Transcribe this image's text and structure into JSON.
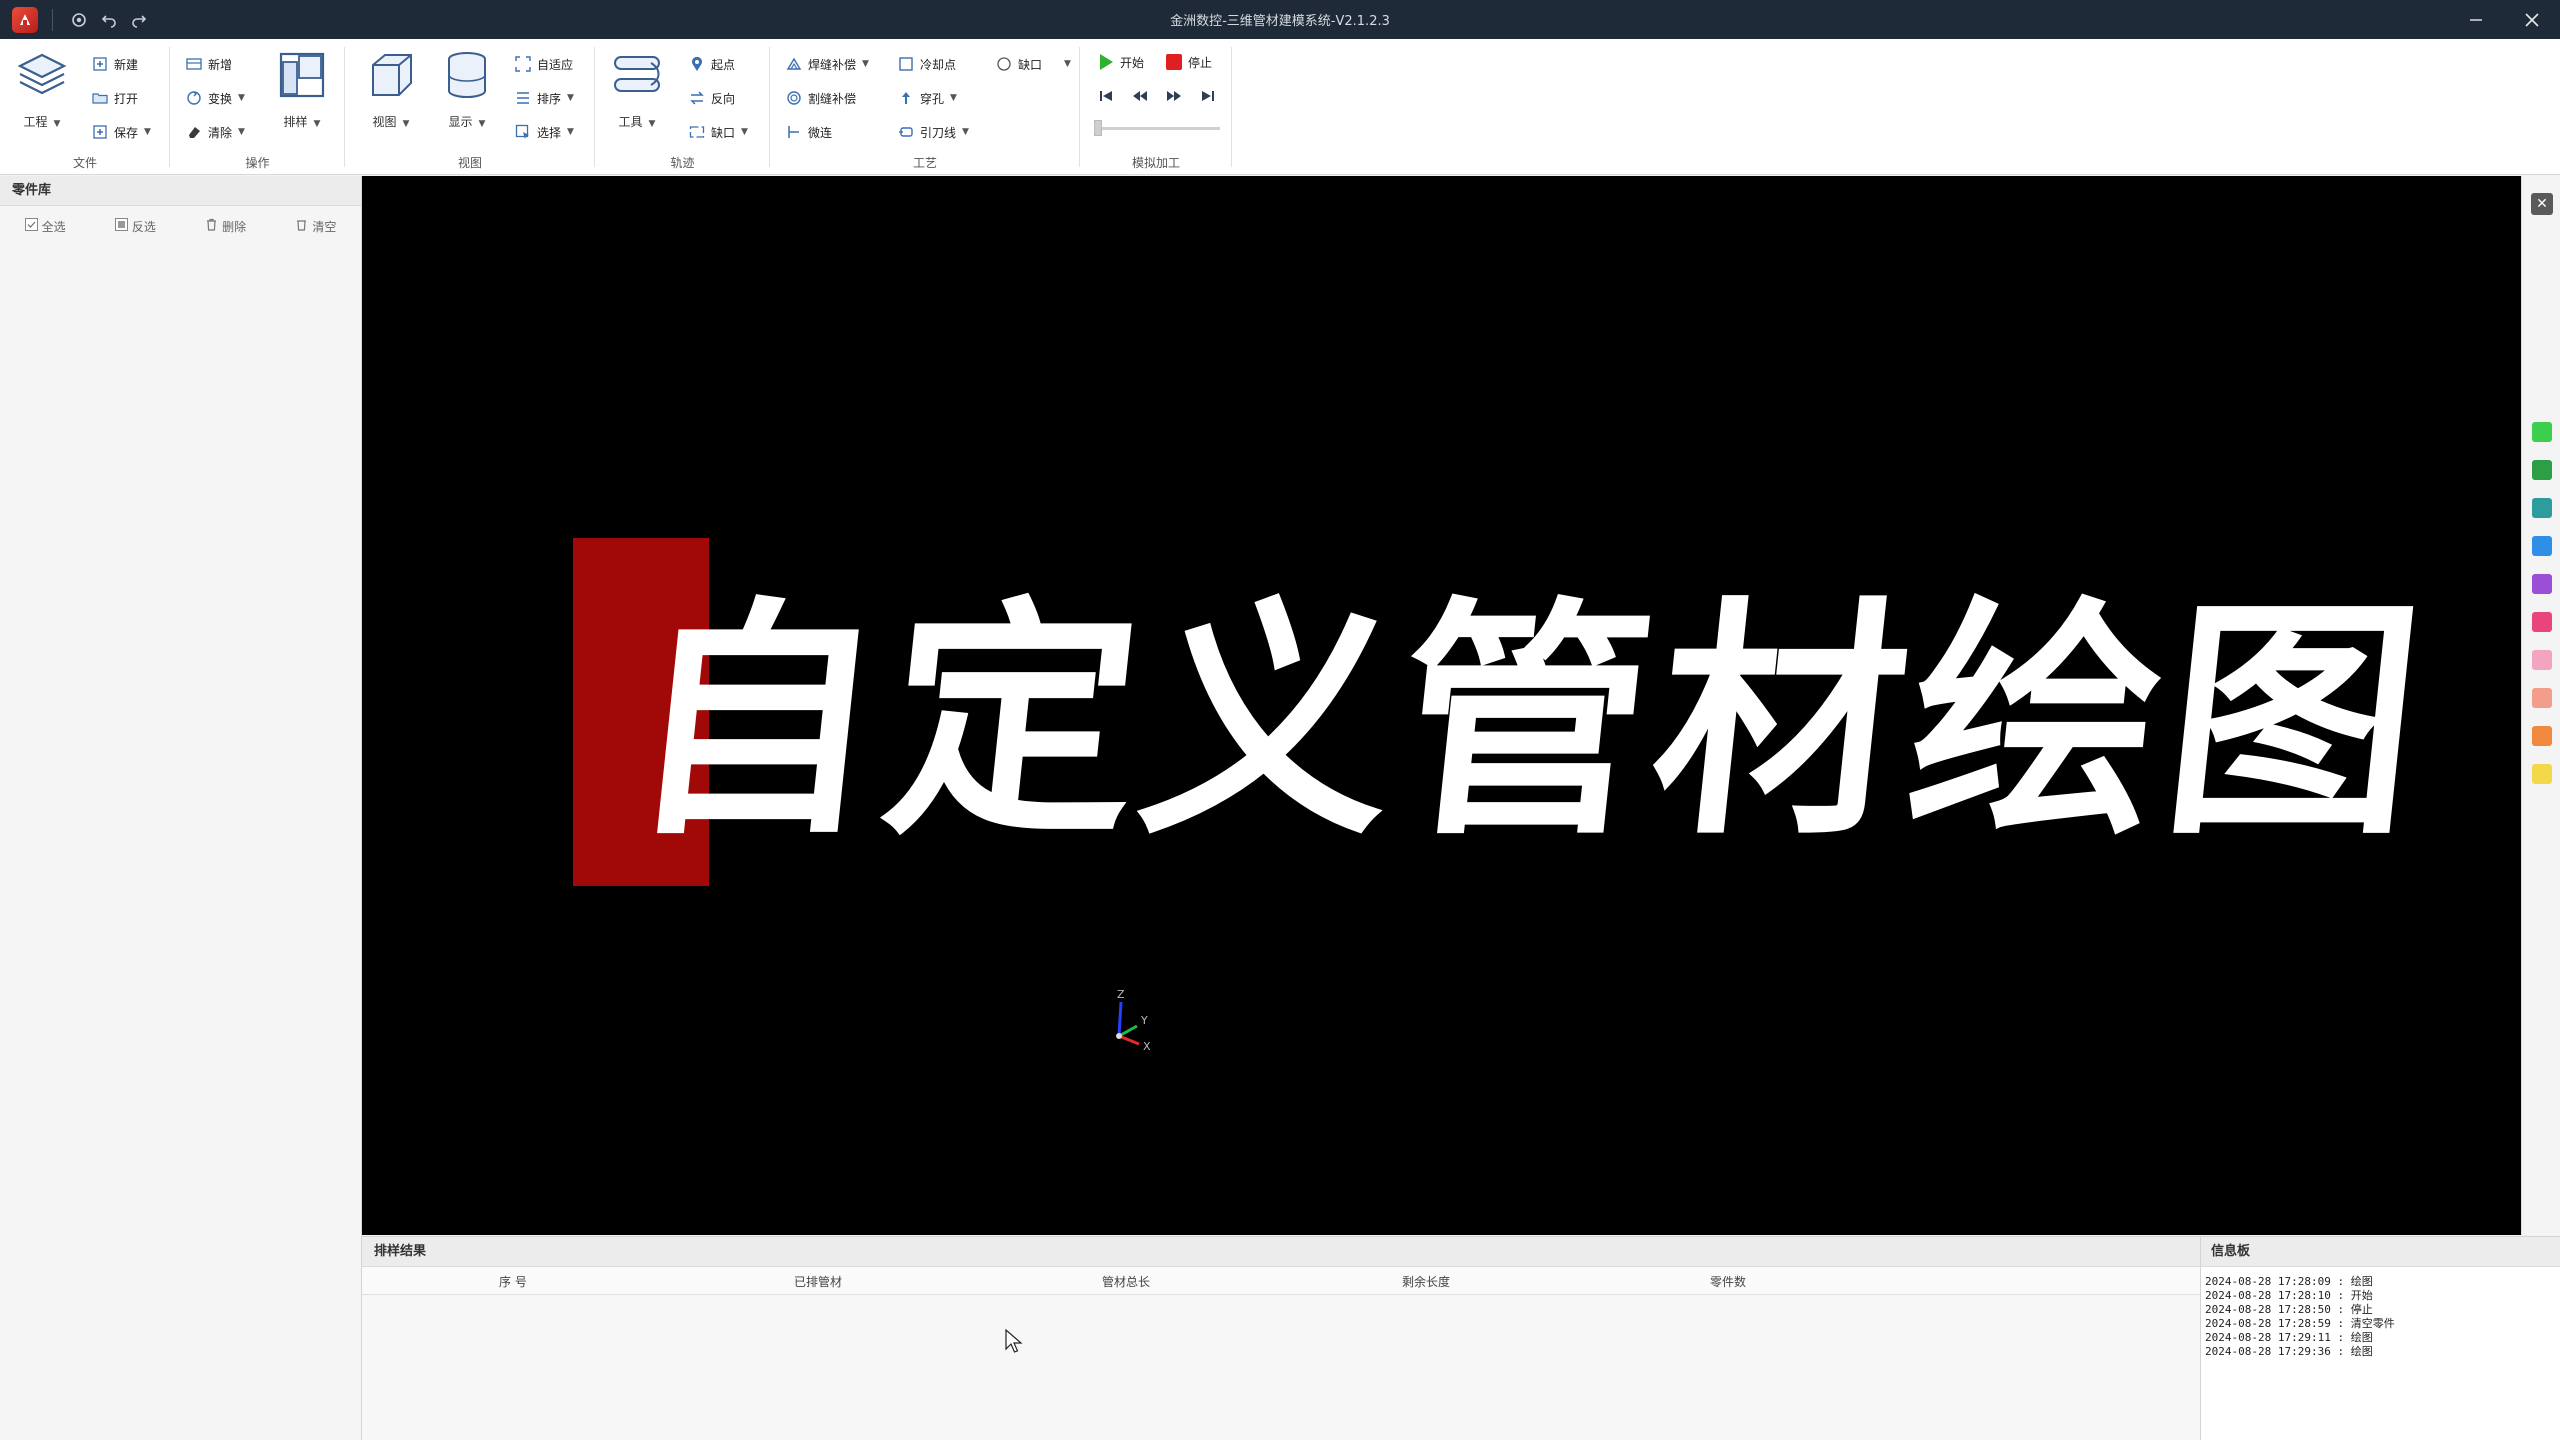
{
  "window": {
    "title": "金洲数控-三维管材建模系统-V2.1.2.3"
  },
  "ribbon": {
    "groups": {
      "file": "文件",
      "operation": "操作",
      "view": "视图",
      "track": "轨迹",
      "process": "工艺",
      "simulation": "模拟加工"
    },
    "file": {
      "project": "工程",
      "new": "新建",
      "open": "打开",
      "save": "保存"
    },
    "operation": {
      "add": "新增",
      "replace": "变换",
      "clear": "清除",
      "nest": "排样"
    },
    "view": {
      "view": "视图",
      "display": "显示",
      "auto_align": "自适应",
      "sort": "排序",
      "select": "选择"
    },
    "track": {
      "tools": "工具",
      "start_point": "起点",
      "reverse": "反向",
      "gap": "缺口"
    },
    "process": {
      "kerf_comp": "焊缝补偿",
      "cut_comp": "割缝补偿",
      "micro_joint": "微连",
      "cool_point": "冷却点",
      "pierce": "穿孔",
      "lead_line": "引刀线",
      "notch": "缺口"
    },
    "simulation": {
      "start": "开始",
      "stop": "停止",
      "progress": 0
    }
  },
  "left_panel": {
    "title": "零件库",
    "tools": {
      "select_all": "全选",
      "invert": "反选",
      "delete": "删除",
      "clear": "清空"
    }
  },
  "viewport": {
    "text": "自定义管材绘图",
    "axes": {
      "z": "Z",
      "y": "Y",
      "x": "X"
    }
  },
  "right_bar": {
    "swatches": [
      "#3ccf4e",
      "#2e9e46",
      "#2c9c9c",
      "#2f8fe6",
      "#9a4fd6",
      "#e8457b",
      "#f3a4c0",
      "#f29e8a",
      "#f0883e",
      "#f5d84a"
    ]
  },
  "result_panel": {
    "title": "排样结果",
    "columns": [
      "序 号",
      "已排管材",
      "管材总长",
      "剩余长度",
      "零件数"
    ]
  },
  "info_panel": {
    "title": "信息板",
    "logs": [
      "2024-08-28 17:28:09 : 绘图",
      "2024-08-28 17:28:10 : 开始",
      "2024-08-28 17:28:50 : 停止",
      "2024-08-28 17:28:59 : 清空零件",
      "2024-08-28 17:29:11 : 绘图",
      "2024-08-28 17:29:36 : 绘图"
    ]
  }
}
